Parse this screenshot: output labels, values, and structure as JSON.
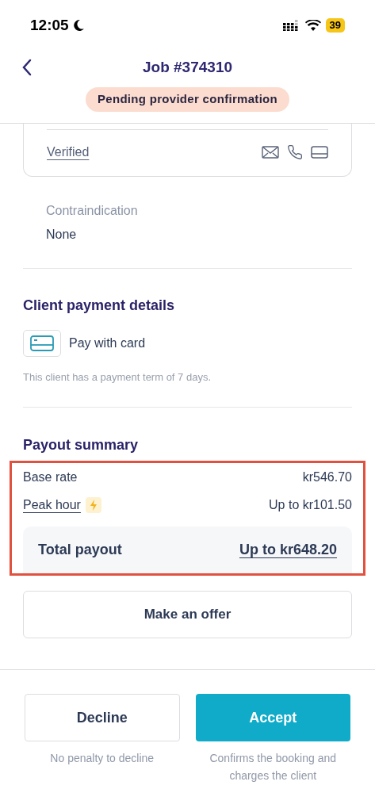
{
  "status_bar": {
    "time": "12:05",
    "battery": "39"
  },
  "header": {
    "title": "Job #374310",
    "status_badge": "Pending provider confirmation"
  },
  "contact_card": {
    "verified_link": "Verified"
  },
  "contraindication": {
    "label": "Contraindication",
    "value": "None"
  },
  "payment": {
    "heading": "Client payment details",
    "method": "Pay with card",
    "note": "This client has a payment term of 7 days."
  },
  "payout": {
    "heading": "Payout summary",
    "highlighted": true,
    "lines": [
      {
        "kind": "plain",
        "label": "Base rate",
        "amount": "kr546.70"
      },
      {
        "kind": "peak",
        "label": "Peak hour",
        "amount": "Up to kr101.50"
      }
    ],
    "total_label": "Total payout",
    "total_amount": "Up to kr648.20"
  },
  "offer_button": "Make an offer",
  "actions": [
    {
      "kind": "secondary",
      "label": "Decline",
      "caption": "No penalty to decline"
    },
    {
      "kind": "primary",
      "label": "Accept",
      "caption": "Confirms the booking and charges the client"
    }
  ]
}
